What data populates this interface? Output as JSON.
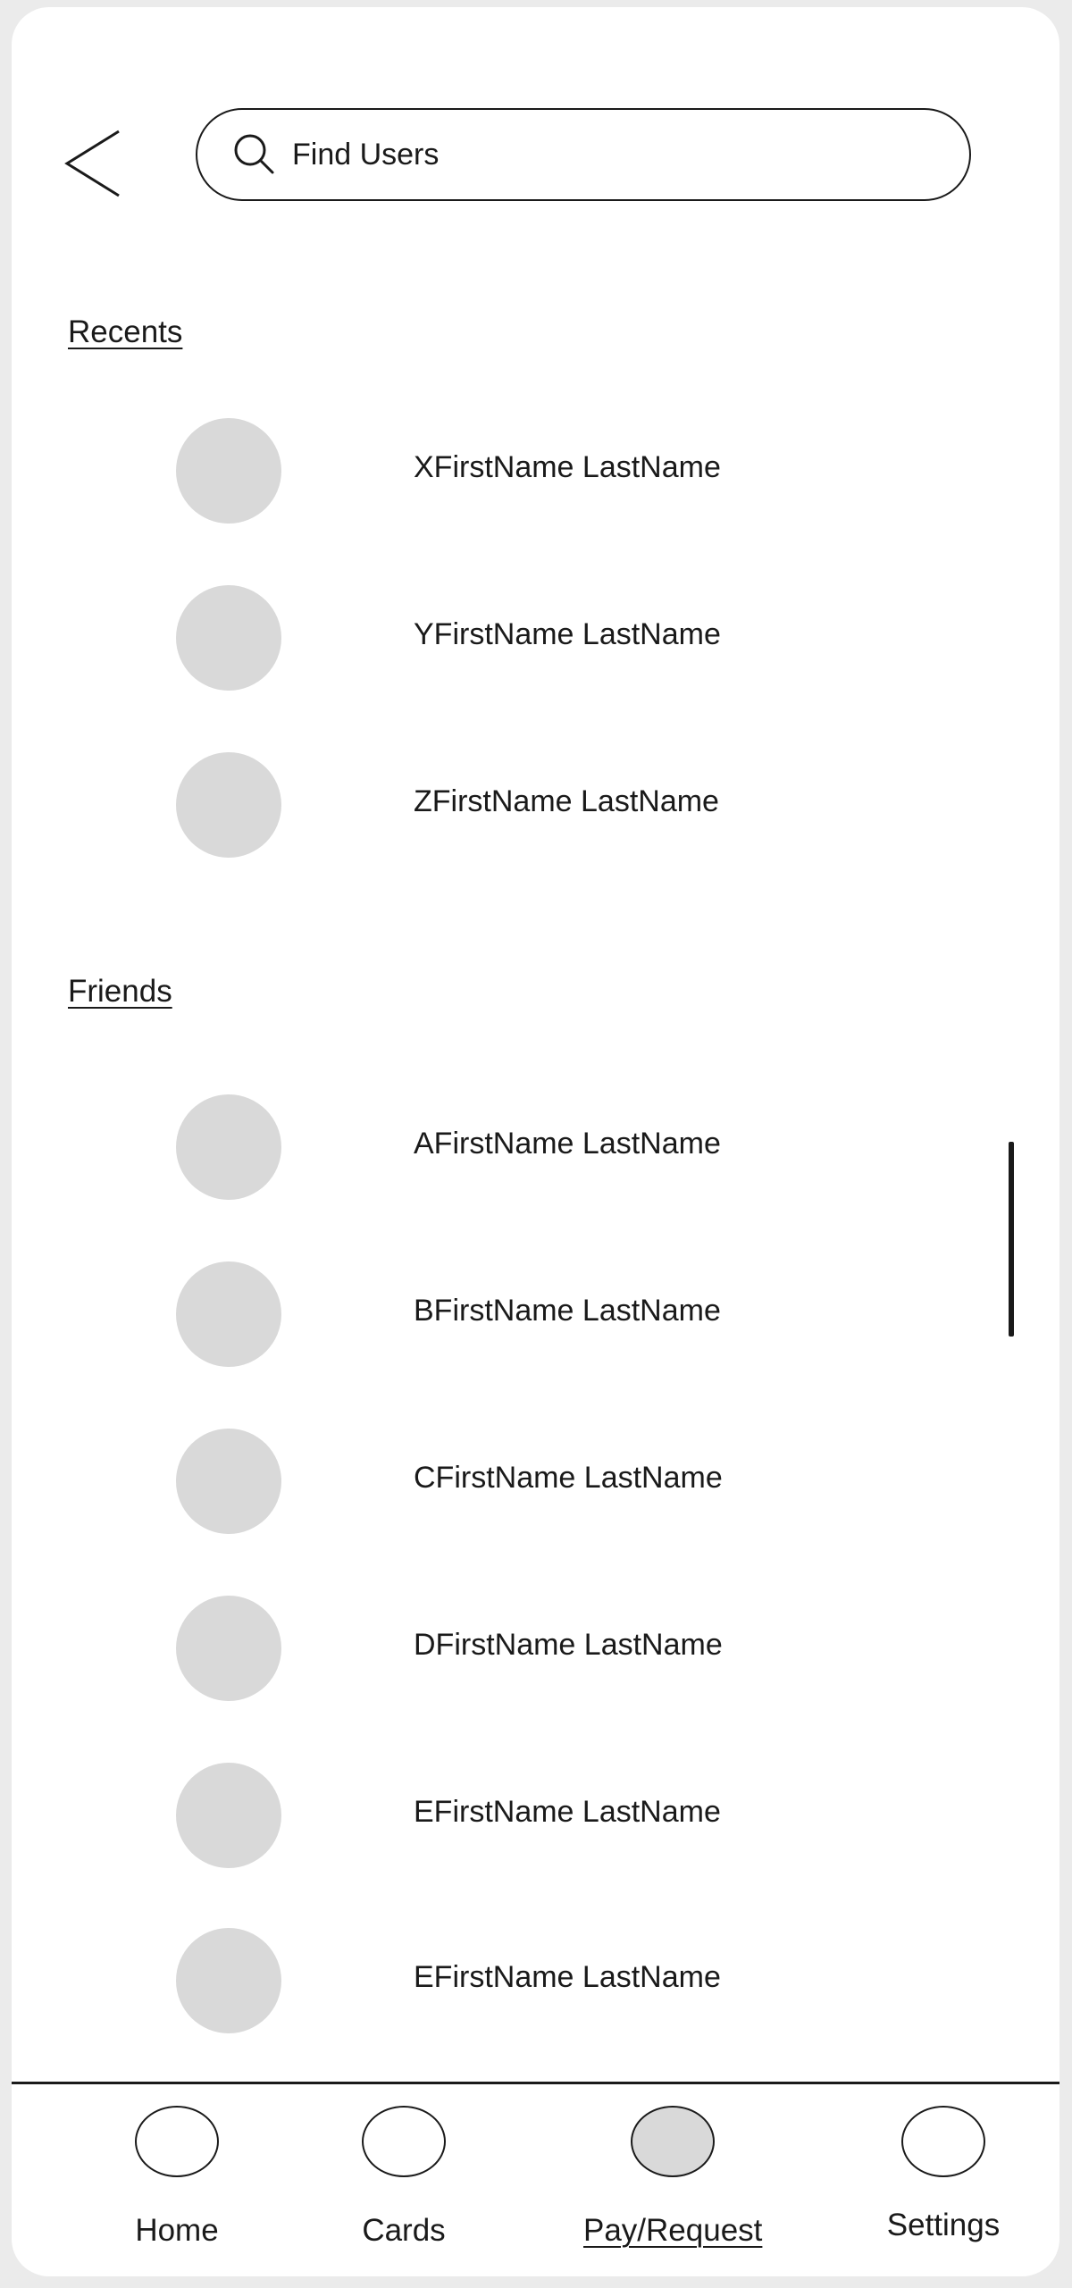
{
  "search": {
    "placeholder": "Find Users",
    "value": ""
  },
  "recents": {
    "title": "Recents",
    "users": [
      {
        "name": "XFirstName LastName"
      },
      {
        "name": "YFirstName LastName"
      },
      {
        "name": "ZFirstName LastName"
      }
    ]
  },
  "friends": {
    "title": "Friends",
    "users": [
      {
        "name": "AFirstName LastName"
      },
      {
        "name": "BFirstName LastName"
      },
      {
        "name": "CFirstName LastName"
      },
      {
        "name": "DFirstName LastName"
      },
      {
        "name": "EFirstName LastName"
      },
      {
        "name": "EFirstName LastName"
      }
    ]
  },
  "bottom_nav": {
    "items": [
      {
        "label": "Home",
        "active": false
      },
      {
        "label": "Cards",
        "active": false
      },
      {
        "label": "Pay/Request",
        "active": true
      },
      {
        "label": "Settings",
        "active": false
      }
    ]
  },
  "colors": {
    "avatar_placeholder": "#d9d9d9",
    "active_nav_fill": "#d9d9d9",
    "stroke": "#1a1a1a"
  }
}
